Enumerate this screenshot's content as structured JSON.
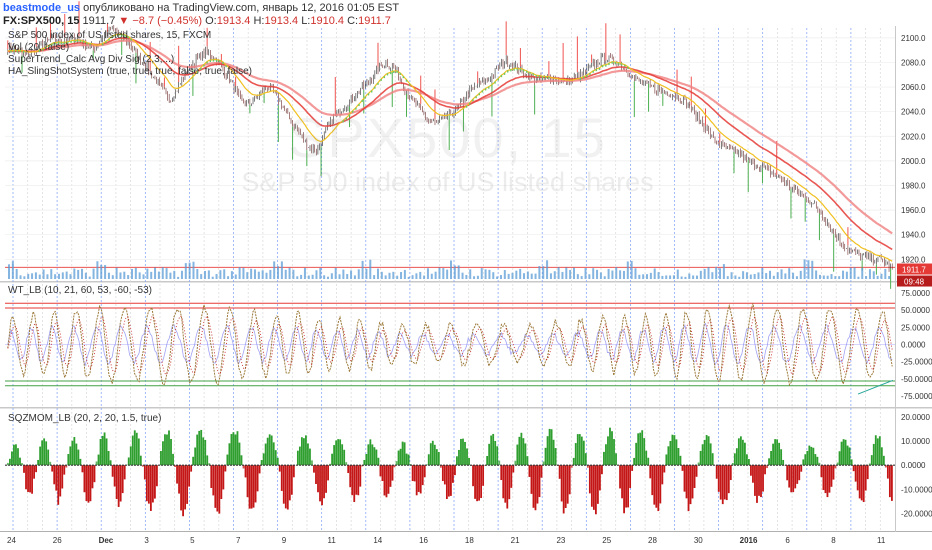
{
  "header": {
    "username": "beastmode_us",
    "published": "опубликовано на TradingView.com, январь 12, 2016 01:05 EST",
    "symbol": "FX:SPX500, 15",
    "last": "1911.7",
    "change": "−8.7 (−0.45%)",
    "ohlc_o_label": "O:",
    "ohlc_o": "1913.4",
    "ohlc_h_label": "H:",
    "ohlc_h": "1913.4",
    "ohlc_l_label": "L:",
    "ohlc_l": "1910.4",
    "ohlc_c_label": "C:",
    "ohlc_c": "1911.7"
  },
  "main_pane": {
    "title": "S&P 500 index of US listed shares, 15, FXCM",
    "ind1": "Vol (20, false)",
    "ind2": "SuperTrend_Calc Avg Div Sig (2,3,...)",
    "ind3": "HA_SlingShotSystem (true, true, true, false, true, false)",
    "watermark_symbol": "SPX500, 15",
    "watermark_desc": "S&P 500 index of US listed shares",
    "price_tag": "1911.7",
    "countdown_tag": "09:48"
  },
  "wt_pane": {
    "title": "WT_LB (10, 21, 60, 53, -60, -53)"
  },
  "sqz_pane": {
    "title": "SQZMOM_LB (20, 2, 20, 1.5, true)"
  },
  "colors": {
    "up_candle": "#4caf50",
    "down_candle": "#ef5350",
    "ema_fast": "#e53935",
    "ema_slow": "#f0c020",
    "volume": "#5b9bd5",
    "wt_line": "#9c7a3a",
    "wt_signal": "#c62828",
    "level": "#e53935",
    "oslevel": "#43a047",
    "hist_pos": "#2e9e2e",
    "hist_neg": "#c41616",
    "vline": "#2962ff"
  },
  "chart_data": [
    {
      "type": "line",
      "title": "S&P 500 index of US listed shares, 15, FXCM",
      "series": [
        {
          "name": "SPX500",
          "values": [
            2092,
            2090,
            2086,
            2089,
            2095,
            2099,
            2097,
            2098,
            2100,
            2094,
            2091,
            2100,
            2108,
            2103,
            2097,
            2086,
            2078,
            2068,
            2058,
            2050,
            2062,
            2074,
            2083,
            2088,
            2085,
            2075,
            2064,
            2050,
            2046,
            2052,
            2060,
            2056,
            2044,
            2032,
            2022,
            2012,
            2008,
            2024,
            2036,
            2043,
            2050,
            2058,
            2064,
            2074,
            2080,
            2075,
            2062,
            2050,
            2042,
            2033,
            2030,
            2036,
            2040,
            2049,
            2058,
            2063,
            2066,
            2075,
            2081,
            2077,
            2072,
            2067,
            2066,
            2067,
            2066,
            2064,
            2067,
            2071,
            2077,
            2082,
            2083,
            2080,
            2074,
            2067,
            2063,
            2060,
            2057,
            2055,
            2052,
            2048,
            2038,
            2030,
            2019,
            2013,
            2009,
            2007,
            2001,
            1997,
            1995,
            1990,
            1986,
            1980,
            1974,
            1970,
            1963,
            1955,
            1944,
            1934,
            1927,
            1924,
            1922,
            1920,
            1919,
            1912
          ]
        }
      ],
      "y_ticks": [
        "2100.0",
        "2080.0",
        "2060.0",
        "2040.0",
        "2020.0",
        "2000.0",
        "1980.0",
        "1960.0",
        "1940.0",
        "1920.0"
      ],
      "ylim": [
        1904,
        2108
      ],
      "x_ticks": [
        "24",
        "26",
        "Dec",
        "3",
        "5",
        "7",
        "9",
        "11",
        "14",
        "16",
        "18",
        "21",
        "23",
        "25",
        "28",
        "30",
        "2016",
        "6",
        "8",
        "11"
      ]
    },
    {
      "type": "line",
      "title": "WT_LB (10, 21, 60, 53, -60, -53)",
      "y_ticks": [
        "75.0000",
        "50.0000",
        "25.0000",
        "0.0000",
        "-25.0000",
        "-50.0000",
        "-75.0000"
      ],
      "ylim": [
        -85,
        85
      ],
      "levels": [
        60,
        53,
        -53,
        -60
      ]
    },
    {
      "type": "bar",
      "title": "SQZMOM_LB (20, 2, 20, 1.5, true)",
      "y_ticks": [
        "20.0000",
        "10.0000",
        "0.0000",
        "-10.0000",
        "-20.0000"
      ],
      "ylim": [
        -26,
        22
      ]
    }
  ]
}
